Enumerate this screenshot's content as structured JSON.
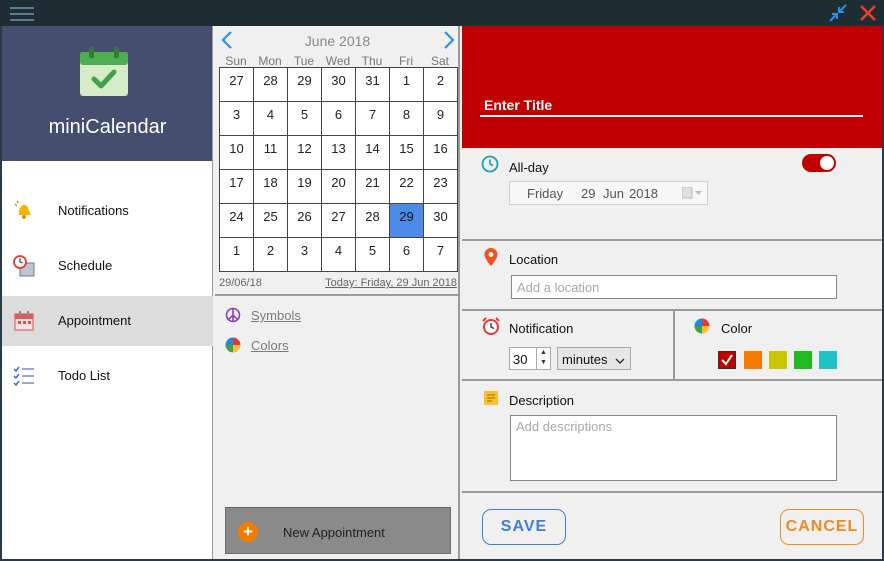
{
  "app": {
    "name": "miniCalendar"
  },
  "sidebar": {
    "items": [
      {
        "label": "Notifications",
        "icon": "bell-icon"
      },
      {
        "label": "Schedule",
        "icon": "schedule-icon"
      },
      {
        "label": "Appointment",
        "icon": "calendar-icon",
        "active": true
      },
      {
        "label": "Todo List",
        "icon": "checklist-icon"
      }
    ]
  },
  "calendar": {
    "month_label": "June 2018",
    "weekdays": [
      "Sun",
      "Mon",
      "Tue",
      "Wed",
      "Thu",
      "Fri",
      "Sat"
    ],
    "days": [
      "27",
      "28",
      "29",
      "30",
      "31",
      "1",
      "2",
      "3",
      "4",
      "5",
      "6",
      "7",
      "8",
      "9",
      "10",
      "11",
      "12",
      "13",
      "14",
      "15",
      "16",
      "17",
      "18",
      "19",
      "20",
      "21",
      "22",
      "23",
      "24",
      "25",
      "26",
      "27",
      "28",
      "29",
      "30",
      "1",
      "2",
      "3",
      "4",
      "5",
      "6",
      "7"
    ],
    "selected_day": "29",
    "selected_date": "29/06/18",
    "today_label": "Today: Friday, 29 Jun 2018",
    "selection_color": "#4c8ce8"
  },
  "tools": {
    "symbols_label": "Symbols",
    "colors_label": "Colors",
    "new_appointment_label": "New Appointment"
  },
  "form": {
    "title_placeholder": "Enter Title",
    "header_color": "#c00000",
    "allday_label": "All-day",
    "allday_on": true,
    "date": {
      "weekday": "Friday",
      "day": "29",
      "month": "Jun",
      "year": "2018"
    },
    "location_label": "Location",
    "location_placeholder": "Add a location",
    "notification_label": "Notification",
    "notification_value": "30",
    "notification_unit": "minutes",
    "color_label": "Color",
    "colors": [
      "#c00000",
      "#f57c00",
      "#c8c800",
      "#22bb22",
      "#1ec4c4"
    ],
    "selected_color": "#c00000",
    "description_label": "Description",
    "description_placeholder": "Add descriptions",
    "save_label": "SAVE",
    "cancel_label": "CANCEL"
  }
}
